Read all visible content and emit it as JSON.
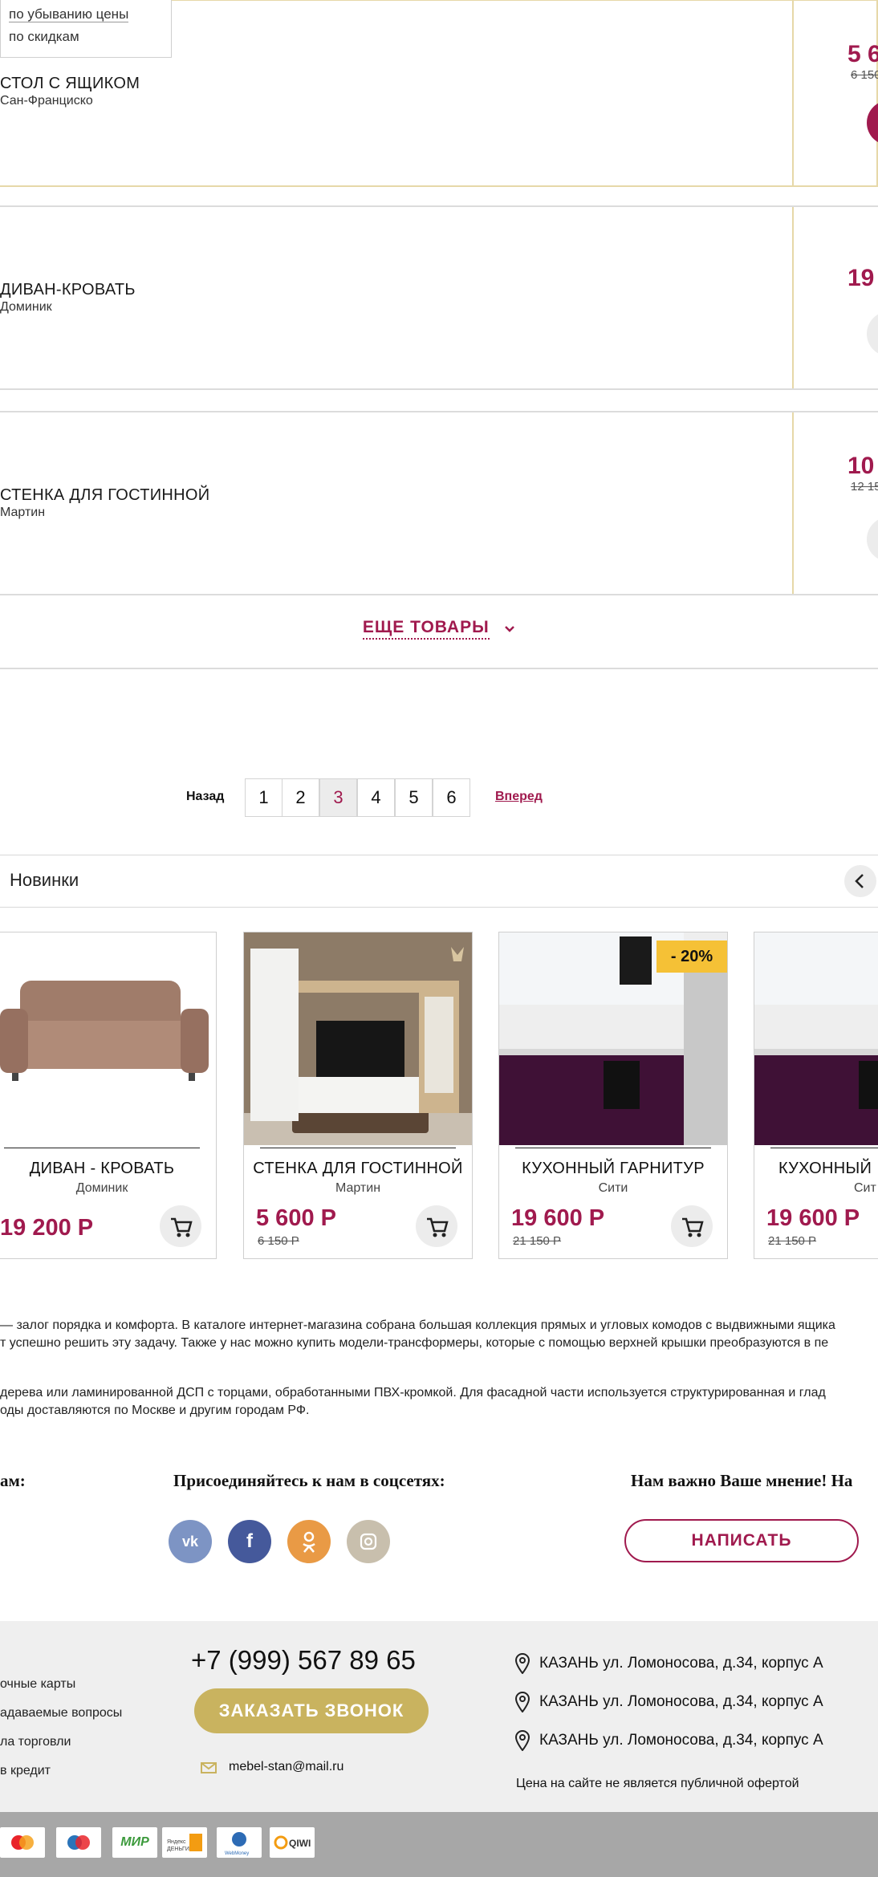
{
  "sort_menu": {
    "option_price_desc": "по убыванию цены",
    "option_discount": "по скидкам"
  },
  "list_items": [
    {
      "title": "СТОЛ С ЯЩИКОМ",
      "subtitle": "Сан-Франциско",
      "price": "5 6",
      "old_price": "6 150"
    },
    {
      "title": "ДИВАН-КРОВАТЬ",
      "subtitle": "Доминик",
      "price": "19",
      "old_price": ""
    },
    {
      "title": "СТЕНКА ДЛЯ ГОСТИННОЙ",
      "subtitle": "Мартин",
      "price": "10",
      "old_price": "12 15"
    }
  ],
  "more_button": "ЕЩЕ ТОВАРЫ",
  "pagination": {
    "prev": "Назад",
    "next": "Вперед",
    "pages": [
      "1",
      "2",
      "3",
      "4",
      "5",
      "6"
    ],
    "current": "3"
  },
  "new_section": {
    "title": "Новинки"
  },
  "products": [
    {
      "title": "ДИВАН - КРОВАТЬ",
      "subtitle": "Доминик",
      "price": "19 200 Р",
      "old_price": "",
      "badge": ""
    },
    {
      "title": "СТЕНКА ДЛЯ ГОСТИННОЙ",
      "subtitle": "Мартин",
      "price": "5 600 Р",
      "old_price": "6 150 Р",
      "badge": ""
    },
    {
      "title": "КУХОННЫЙ ГАРНИТУР",
      "subtitle": "Сити",
      "price": "19 600 Р",
      "old_price": "21 150 Р",
      "badge": "- 20%"
    },
    {
      "title": "КУХОННЫЙ",
      "subtitle": "Сит",
      "price": "19 600 Р",
      "old_price": "21 150 Р",
      "badge": ""
    }
  ],
  "seo_text": {
    "line1": "— залог порядка и комфорта. В каталоге интернет-магазина собрана большая коллекция прямых и угловых комодов с выдвижными ящика",
    "line2": "т успешно решить эту задачу. Также у нас можно купить модели-трансформеры, которые с помощью верхней крышки преобразуются в пе",
    "line3": "дерева или ламинированной ДСП с торцами, обработанными ПВХ-кромкой. Для фасадной части используется структурированная и глад",
    "line4": "оды доставляются по Москве и другим городам РФ."
  },
  "social_block": {
    "left_heading": "ам:",
    "join_heading": "Присоединяйтесь к нам в соцсетях:",
    "feedback_heading": "Нам важно Ваше мнение! На",
    "write_button": "НАПИСАТЬ",
    "icons": [
      "vk-icon",
      "facebook-icon",
      "odnoklassniki-icon",
      "instagram-icon"
    ]
  },
  "footer": {
    "col1_heading": "",
    "links": [
      "очные карты",
      "адаваемые вопросы",
      "ла торговли",
      " в кредит"
    ],
    "phone": "+7 (999) 567 89 65",
    "callback_button": "ЗАКАЗАТЬ ЗВОНОК",
    "email": "mebel-stan@mail.ru",
    "addresses": [
      "КАЗАНЬ ул. Ломоносова, д.34, корпус А",
      "КАЗАНЬ ул. Ломоносова, д.34, корпус А",
      "КАЗАНЬ ул. Ломоносова, д.34, корпус А"
    ],
    "disclaimer": "Цена на сайте не является публичной офертой"
  },
  "payments": [
    "MasterCard",
    "Maestro",
    "МИР",
    "Яндекс Деньги",
    "WebMoney",
    "QIWI"
  ],
  "colors": {
    "accent": "#a01a4e",
    "gold": "#c9b35f",
    "divider": "#e6d8a8",
    "footer_bg": "#efefef",
    "paybar_bg": "#a7a7a7"
  }
}
